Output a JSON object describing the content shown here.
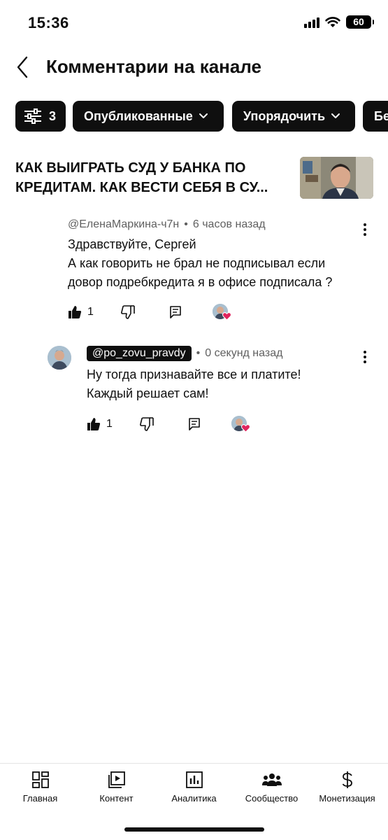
{
  "status_bar": {
    "time": "15:36",
    "battery": "60"
  },
  "header": {
    "title": "Комментарии на канале"
  },
  "filters": {
    "filter_count": "3",
    "published_label": "Опубликованные",
    "sort_label": "Упорядочить",
    "partial_label": "Бе"
  },
  "video": {
    "title": "КАК ВЫИГРАТЬ СУД У БАНКА ПО КРЕДИТАМ. КАК ВЕСТИ СЕБЯ В СУ..."
  },
  "comments": [
    {
      "author": "@ЕленаМаркина-ч7н",
      "time": "6 часов назад",
      "lines": [
        "Здравствуйте, Сергей",
        "А как говорить не брал не подписывал если",
        "довор подребкредита я в офисе подписала ?"
      ],
      "likes": "1"
    },
    {
      "author": "@po_zovu_pravdy",
      "time": "0 секунд назад",
      "lines": [
        "Ну тогда признавайте все и платите!",
        "Каждый решает сам!"
      ],
      "likes": "1"
    }
  ],
  "bottom_nav": [
    {
      "label": "Главная",
      "icon": "dashboard-icon"
    },
    {
      "label": "Контент",
      "icon": "content-icon"
    },
    {
      "label": "Аналитика",
      "icon": "analytics-icon"
    },
    {
      "label": "Сообщество",
      "icon": "community-icon"
    },
    {
      "label": "Монетизация",
      "icon": "dollar-icon"
    }
  ],
  "colors": {
    "accent": "#0f0f0f",
    "secondary_text": "#606060",
    "heart": "#e0245e"
  }
}
